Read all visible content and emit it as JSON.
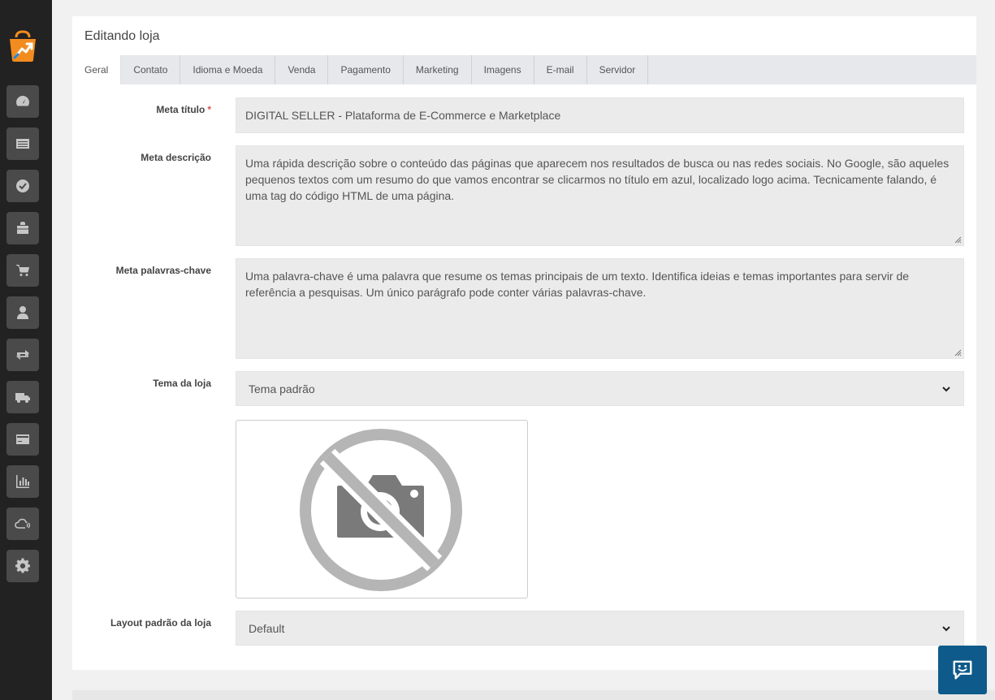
{
  "page": {
    "title": "Editando loja"
  },
  "tabs": [
    "Geral",
    "Contato",
    "Idioma e Moeda",
    "Venda",
    "Pagamento",
    "Marketing",
    "Imagens",
    "E-mail",
    "Servidor"
  ],
  "form": {
    "meta_titulo": {
      "label": "Meta título",
      "required_mark": "*",
      "value": "DIGITAL SELLER - Plataforma de E-Commerce e Marketplace"
    },
    "meta_descricao": {
      "label": "Meta descrição",
      "value": "Uma rápida descrição sobre o conteúdo das páginas que aparecem nos resultados de busca ou nas redes sociais. No Google, são aqueles pequenos textos com um resumo do que vamos encontrar se clicarmos no título em azul, localizado logo acima. Tecnicamente falando, é uma tag do código HTML de uma página."
    },
    "meta_palavras": {
      "label": "Meta palavras-chave",
      "value": "Uma palavra-chave é uma palavra que resume os temas principais de um texto. Identifica ideias e temas importantes para servir de referência a pesquisas. Um único parágrafo pode conter várias palavras-chave."
    },
    "tema": {
      "label": "Tema da loja",
      "value": "Tema padrão"
    },
    "layout": {
      "label": "Layout padrão da loja",
      "value": "Default"
    }
  },
  "icons": {
    "sidebar": [
      "dashboard-icon",
      "catalog-icon",
      "check-circle-icon",
      "shopping-bag-icon",
      "cart-icon",
      "user-icon",
      "exchange-icon",
      "truck-icon",
      "credit-card-icon",
      "chart-icon",
      "cloud-icon",
      "gear-icon"
    ],
    "preview": "no-image-camera-icon",
    "chat": "chat-support-icon"
  },
  "colors": {
    "sidebar": "#222222",
    "accent": "#0e5a8a",
    "logo_orange": "#f28c1e"
  }
}
